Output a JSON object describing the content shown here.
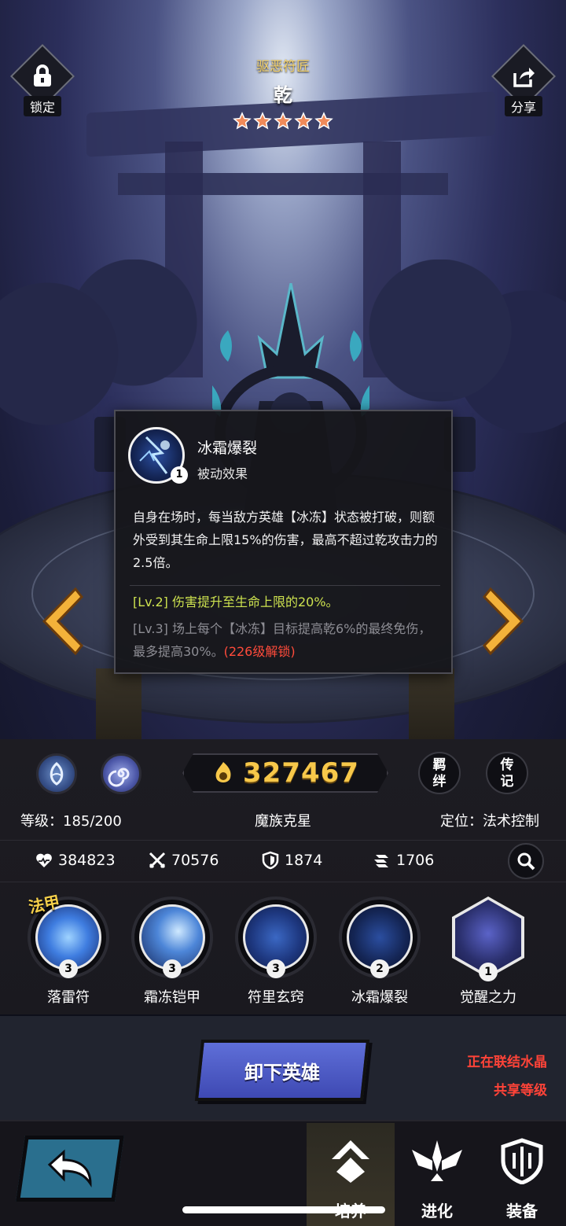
{
  "header": {
    "lock_label": "锁定",
    "share_label": "分享",
    "hero_class": "驱恶符匠",
    "hero_name": "乾",
    "stars": 5
  },
  "tooltip": {
    "skill_name": "冰霜爆裂",
    "skill_type": "被动效果",
    "skill_level": "1",
    "description": "自身在场时，每当敌方英雄【冰冻】状态被打破，则额外受到其生命上限15%的伤害，最高不超过乾攻击力的2.5倍。",
    "lv2": "[Lv.2] 伤害提升至生命上限的20%。",
    "lv3": "[Lv.3] 场上每个【冰冻】目标提高乾6%的最终免伤，最多提高30%。",
    "lv3_lock": "(226级解锁)"
  },
  "power": {
    "value": "327467"
  },
  "side_buttons": {
    "bond": "羁\n绊",
    "biography": "传\n记"
  },
  "info": {
    "level": "等级：185/200",
    "trait": "魔族克星",
    "role": "定位：法术控制"
  },
  "stats": {
    "hp": "384823",
    "attack": "70576",
    "defense": "1874",
    "speed": "1706"
  },
  "skills": {
    "badge": "法甲",
    "items": [
      {
        "name": "落雷符",
        "level": "3"
      },
      {
        "name": "霜冻铠甲",
        "level": "3"
      },
      {
        "name": "符里玄窍",
        "level": "3"
      },
      {
        "name": "冰霜爆裂",
        "level": "2"
      },
      {
        "name": "觉醒之力",
        "level": "1"
      }
    ]
  },
  "actions": {
    "unload": "卸下英雄",
    "link_line1": "正在联结水晶",
    "link_line2": "共享等级"
  },
  "nav": {
    "cultivate": "培养",
    "evolve": "进化",
    "equip": "装备"
  },
  "colors": {
    "gold": "#f7c84a",
    "lv2_green": "#cde24f",
    "lock_red": "#ff4b3b",
    "button_blue": "#4e5bc6"
  }
}
